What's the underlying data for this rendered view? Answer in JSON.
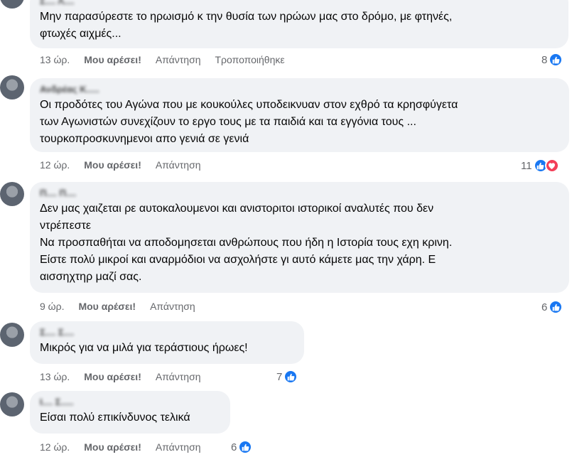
{
  "colors": {
    "like": "#1877f2",
    "love": "#f33e58",
    "bubble": "#f0f2f5",
    "meta": "#65676b"
  },
  "comments": [
    {
      "author": "Σ.... Λ....",
      "text": "Μην παρασύρεστε το ηρωισμό κ την θυσία των ηρώων μας στο δρόμο, με φτηνές,\nφτωχές αιχμές...",
      "time": "13 ώρ.",
      "like_label": "Μου αρέσει!",
      "reply_label": "Απάντηση",
      "edited_label": "Τροποποιήθηκε",
      "reaction_count": "8",
      "reactions": [
        "like-icon"
      ]
    },
    {
      "author": "Ανδρέας Κ.....",
      "text": "Οι προδότες του Αγώνα που με κουκούλες υποδεικνυαν στον εχθρό τα κρησφύγετα\nτων Αγωνιστών συνεχίζουν το εργο τους με τα παιδιά και τα εγγόνια τους ...\nτουρκοπροσκυνημενοι απο γενιά σε γενιά",
      "time": "12 ώρ.",
      "like_label": "Μου αρέσει!",
      "reply_label": "Απάντηση",
      "reaction_count": "11",
      "reactions": [
        "like-icon",
        "love-icon"
      ]
    },
    {
      "author": "Π.... Π....",
      "text": "Δεν μας χαιζεται ρε αυτοκαλουμενοι και ανιστοριτοι ιστορικοί αναλυτές που δεν\nντρέπεστε\nΝα προσπαθήται να αποδομησεται ανθρώπους που ήδη η Ιστορία τους εχη κρινη.\nΕίστε πολύ μικροί και αναρμόδιοι να ασχολήστε γι αυτό κάμετε μας την χάρη. Ε\nαισσηχτηρ μαζί σας.",
      "time": "9 ώρ.",
      "like_label": "Μου αρέσει!",
      "reply_label": "Απάντηση",
      "reaction_count": "6",
      "reactions": [
        "like-icon"
      ]
    },
    {
      "author": "Σ.... Σ....",
      "text": "Μικρός για να μιλά για τεράστιους ήρωες!",
      "time": "13 ώρ.",
      "like_label": "Μου αρέσει!",
      "reply_label": "Απάντηση",
      "reaction_count": "7",
      "reactions": [
        "like-icon"
      ]
    },
    {
      "author": "Ι.... Σ.....",
      "text": "Είσαι πολύ επικίνδυνος τελικά",
      "time": "12 ώρ.",
      "like_label": "Μου αρέσει!",
      "reply_label": "Απάντηση",
      "reaction_count": "6",
      "reactions": [
        "like-icon"
      ]
    }
  ]
}
